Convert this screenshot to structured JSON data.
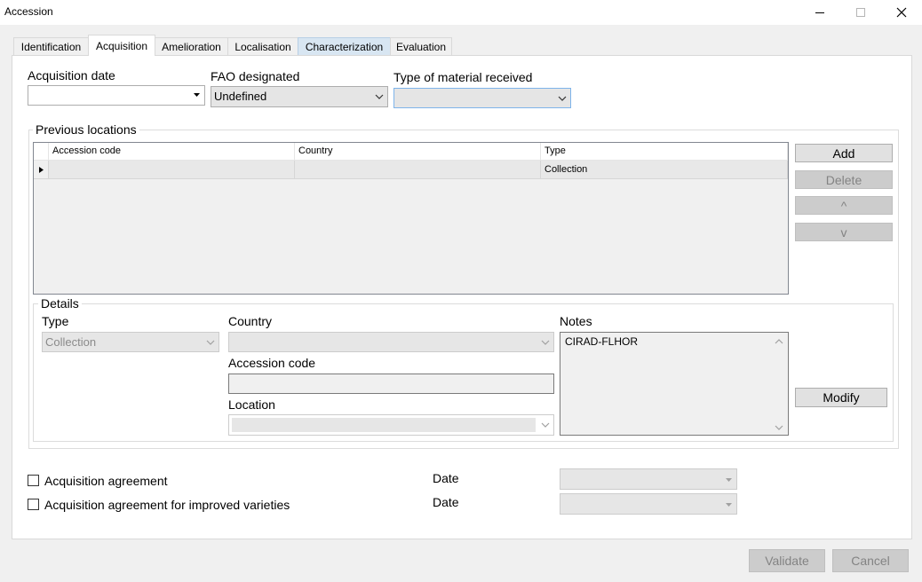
{
  "window": {
    "title": "Accession"
  },
  "tabs": [
    "Identification",
    "Acquisition",
    "Amelioration",
    "Localisation",
    "Characterization",
    "Evaluation"
  ],
  "acquisition": {
    "acquisition_date_label": "Acquisition date",
    "acquisition_date_value": "",
    "fao_label": "FAO designated",
    "fao_value": "Undefined",
    "material_label": "Type of material received",
    "material_value": ""
  },
  "previous_locations": {
    "title": "Previous locations",
    "columns": [
      "Accession code",
      "Country",
      "Type"
    ],
    "rows": [
      {
        "accession_code": "",
        "country": "",
        "type": "Collection"
      }
    ],
    "buttons": {
      "add": "Add",
      "delete": "Delete",
      "up": "^",
      "down": "v"
    }
  },
  "details": {
    "title": "Details",
    "type_label": "Type",
    "type_value": "Collection",
    "country_label": "Country",
    "country_value": "",
    "accession_code_label": "Accession code",
    "accession_code_value": "",
    "location_label": "Location",
    "location_value": "",
    "notes_label": "Notes",
    "notes_value": "CIRAD-FLHOR",
    "modify": "Modify"
  },
  "agreements": [
    {
      "label": "Acquisition agreement",
      "checked": false,
      "date_label": "Date",
      "date_value": ""
    },
    {
      "label": "Acquisition agreement for improved varieties",
      "checked": false,
      "date_label": "Date",
      "date_value": ""
    }
  ],
  "footer": {
    "validate": "Validate",
    "cancel": "Cancel"
  }
}
